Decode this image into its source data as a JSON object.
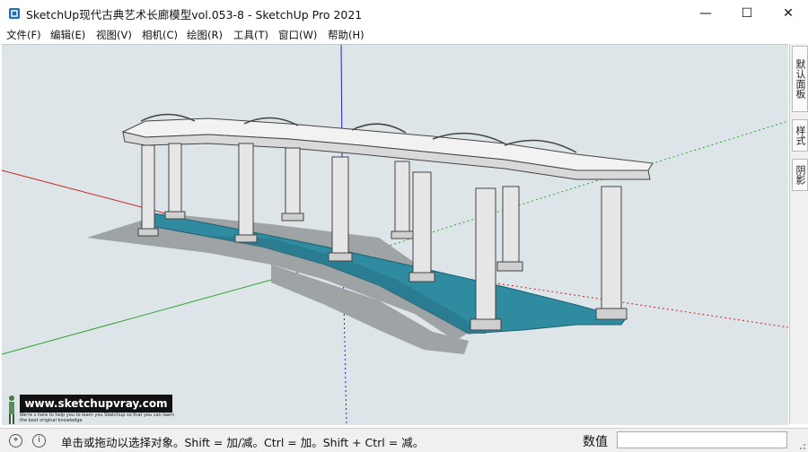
{
  "window": {
    "title": "SketchUp现代古典艺术长廊模型vol.053-8 - SketchUp Pro 2021",
    "minimize_glyph": "—",
    "maximize_glyph": "☐",
    "close_glyph": "✕",
    "app_icon": "sketchup-icon"
  },
  "menu": {
    "items": [
      "文件(F)",
      "编辑(E)",
      "视图(V)",
      "相机(C)",
      "绘图(R)",
      "工具(T)",
      "窗口(W)",
      "帮助(H)"
    ]
  },
  "tray": {
    "tabs": [
      "默认面板",
      "样式",
      "阴影"
    ]
  },
  "status": {
    "message": "单击或拖动以选择对象。Shift = 加/减。Ctrl = 加。Shift + Ctrl = 减。",
    "vcb_label": "数值",
    "vcb_value": ""
  },
  "watermark": {
    "url": "www.sketchupvray.com",
    "tagline": "We're s here to help you to learn you Sketchup so that you can learn the best original knowledge"
  },
  "colors": {
    "viewport_bg": "#dde5e8",
    "axis_red": "#cc2222",
    "axis_green": "#2aa52a",
    "axis_blue": "#2222cc",
    "floor": "#2f8ba0",
    "shadow": "#9ea3a6",
    "column": "#e6e6e6"
  }
}
